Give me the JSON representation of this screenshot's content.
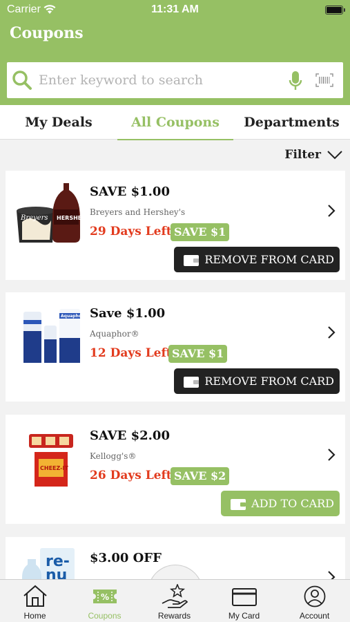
{
  "status_bar": {
    "carrier": "Carrier",
    "time": "11:31 AM"
  },
  "header": {
    "title": "Coupons"
  },
  "search": {
    "placeholder": "Enter keyword to search"
  },
  "tabs": [
    {
      "label": "My Deals",
      "active": false
    },
    {
      "label": "All Coupons",
      "active": true
    },
    {
      "label": "Departments",
      "active": false
    }
  ],
  "filter": {
    "label": "Filter"
  },
  "coupons": [
    {
      "headline": "SAVE $1.00",
      "brand": "Breyers and Hershey's",
      "days_left": "29 Days Left",
      "badge": "SAVE $1",
      "action": "REMOVE FROM CARD",
      "state": "remove"
    },
    {
      "headline": "Save $1.00",
      "brand": "Aquaphor®",
      "days_left": "12 Days Left",
      "badge": "SAVE $1",
      "action": "REMOVE FROM CARD",
      "state": "remove"
    },
    {
      "headline": "SAVE $2.00",
      "brand": "Kellogg's®",
      "days_left": "26 Days Left",
      "badge": "SAVE $2",
      "action": "ADD TO CARD",
      "state": "add"
    },
    {
      "headline": "$3.00 OFF"
    }
  ],
  "bottom_nav": [
    {
      "label": "Home",
      "icon": "home-icon",
      "active": false
    },
    {
      "label": "Coupons",
      "icon": "coupon-icon",
      "active": true
    },
    {
      "label": "Rewards",
      "icon": "rewards-icon",
      "active": false
    },
    {
      "label": "My Card",
      "icon": "card-icon",
      "active": false
    },
    {
      "label": "Account",
      "icon": "account-icon",
      "active": false
    }
  ],
  "colors": {
    "brand_green": "#96c064",
    "expiry_red": "#e23b1e",
    "action_dark": "#222222"
  }
}
